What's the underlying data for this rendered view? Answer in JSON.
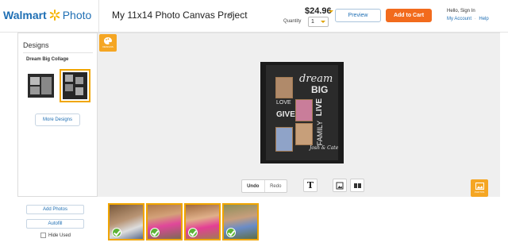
{
  "header": {
    "brand_walmart": "Walmart",
    "brand_photo": "Photo",
    "project_title": "My 11x14 Photo Canvas Project",
    "price": "$24.96",
    "quantity_label": "Quantity",
    "quantity_value": "1",
    "preview_label": "Preview",
    "add_to_cart_label": "Add to Cart",
    "hello_text": "Hello, Sign In",
    "account_text": "My Account",
    "account_sep": "·",
    "help_text": "Help"
  },
  "left_panel": {
    "heading": "Designs",
    "collage_name": "Dream Big Collage",
    "more_designs_label": "More Designs"
  },
  "canvas": {
    "design_tab_label": "DESIGNS",
    "photo_tab_label": "PHOTOS",
    "chalk_dream": "dream",
    "chalk_big": "BIG",
    "chalk_live": "LIVE",
    "chalk_love": "LOVE",
    "chalk_give": "GIVE",
    "chalk_family": "FAMILY",
    "chalk_names": "Josh & Cate"
  },
  "toolbar": {
    "undo_label": "Undo",
    "redo_label": "Redo",
    "text_tool_glyph": "T"
  },
  "bottom": {
    "add_photos_label": "Add Photos",
    "autofill_label": "Autofill",
    "hide_used_label": "Hide Used"
  },
  "icons": {
    "brand_spark": "spark-icon",
    "edit": "pencil-icon",
    "text_tool": "text-tool-icon",
    "photo_frame_tool": "photo-frame-icon",
    "layout_tool": "layout-icon",
    "check": "check-icon"
  },
  "colors": {
    "brand_blue": "#1f6fb4",
    "accent_orange": "#f26b1d",
    "tab_orange": "#f5a623",
    "check_green": "#5cb336"
  }
}
